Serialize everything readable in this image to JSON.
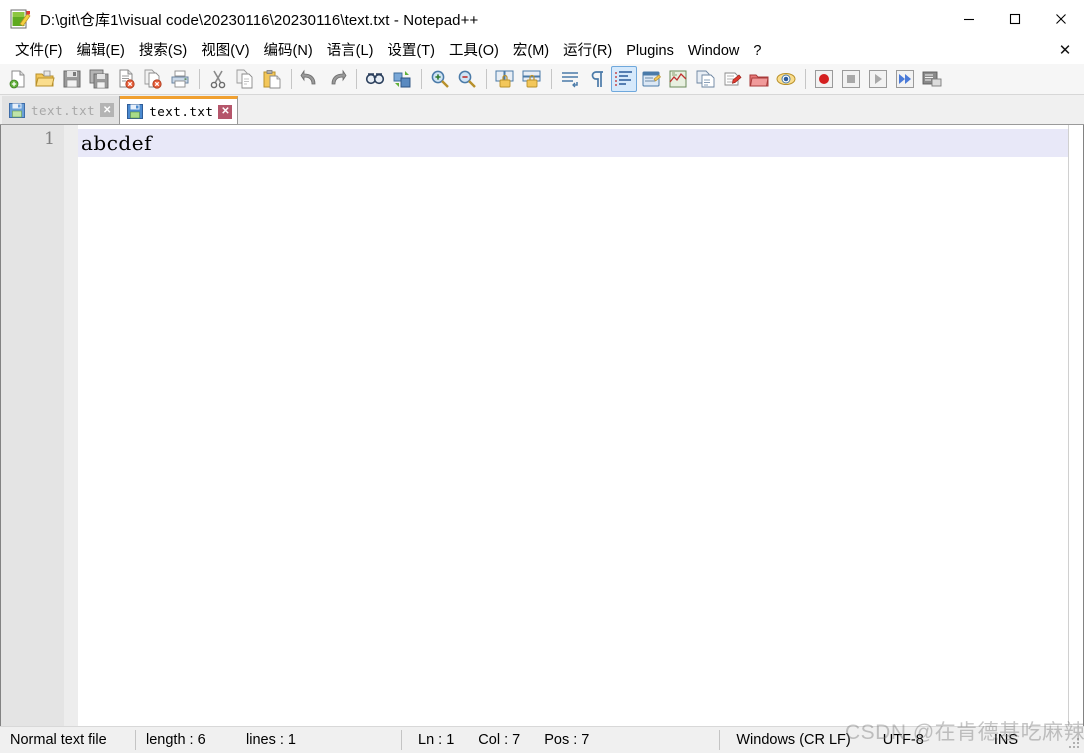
{
  "window": {
    "title": "D:\\git\\仓库1\\visual code\\20230116\\20230116\\text.txt - Notepad++",
    "app_icon": "notepad-plus-plus-icon",
    "controls": {
      "minimize": "—",
      "maximize": "☐",
      "close": "✕"
    }
  },
  "menubar": {
    "items": [
      {
        "label": "文件(F)",
        "name": "menu-file"
      },
      {
        "label": "编辑(E)",
        "name": "menu-edit"
      },
      {
        "label": "搜索(S)",
        "name": "menu-search"
      },
      {
        "label": "视图(V)",
        "name": "menu-view"
      },
      {
        "label": "编码(N)",
        "name": "menu-encoding"
      },
      {
        "label": "语言(L)",
        "name": "menu-language"
      },
      {
        "label": "设置(T)",
        "name": "menu-settings"
      },
      {
        "label": "工具(O)",
        "name": "menu-tools"
      },
      {
        "label": "宏(M)",
        "name": "menu-macro"
      },
      {
        "label": "运行(R)",
        "name": "menu-run"
      },
      {
        "label": "Plugins",
        "name": "menu-plugins"
      },
      {
        "label": "Window",
        "name": "menu-window"
      },
      {
        "label": "?",
        "name": "menu-help"
      }
    ],
    "close_document": "✕"
  },
  "toolbar": {
    "buttons": [
      {
        "name": "new-file-icon",
        "type": "icon"
      },
      {
        "name": "open-file-icon",
        "type": "icon"
      },
      {
        "name": "save-icon",
        "type": "icon"
      },
      {
        "name": "save-all-icon",
        "type": "icon"
      },
      {
        "name": "close-file-icon",
        "type": "icon"
      },
      {
        "name": "close-all-files-icon",
        "type": "icon"
      },
      {
        "name": "print-icon",
        "type": "icon"
      },
      {
        "name": "separator",
        "type": "sep"
      },
      {
        "name": "cut-icon",
        "type": "icon"
      },
      {
        "name": "copy-icon",
        "type": "icon"
      },
      {
        "name": "paste-icon",
        "type": "icon"
      },
      {
        "name": "separator",
        "type": "sep"
      },
      {
        "name": "undo-icon",
        "type": "icon"
      },
      {
        "name": "redo-icon",
        "type": "icon"
      },
      {
        "name": "separator",
        "type": "sep"
      },
      {
        "name": "find-icon",
        "type": "icon"
      },
      {
        "name": "replace-icon",
        "type": "icon"
      },
      {
        "name": "separator",
        "type": "sep"
      },
      {
        "name": "zoom-in-icon",
        "type": "icon"
      },
      {
        "name": "zoom-out-icon",
        "type": "icon"
      },
      {
        "name": "separator",
        "type": "sep"
      },
      {
        "name": "sync-vertical-scroll-icon",
        "type": "icon"
      },
      {
        "name": "sync-horizontal-scroll-icon",
        "type": "icon"
      },
      {
        "name": "separator",
        "type": "sep"
      },
      {
        "name": "word-wrap-icon",
        "type": "icon"
      },
      {
        "name": "show-all-characters-icon",
        "type": "icon"
      },
      {
        "name": "show-indent-guide-icon",
        "type": "icon",
        "active": true
      },
      {
        "name": "user-defined-dialog-icon",
        "type": "icon"
      },
      {
        "name": "document-map-icon",
        "type": "icon"
      },
      {
        "name": "function-list-icon",
        "type": "icon"
      },
      {
        "name": "folder-as-workspace-icon",
        "type": "icon"
      },
      {
        "name": "monitoring-icon",
        "type": "icon"
      },
      {
        "name": "document-preview-icon",
        "type": "icon"
      },
      {
        "name": "separator",
        "type": "sep"
      },
      {
        "name": "record-macro-icon",
        "type": "icon"
      },
      {
        "name": "stop-recording-icon",
        "type": "icon"
      },
      {
        "name": "play-macro-icon",
        "type": "icon"
      },
      {
        "name": "run-macro-multiple-icon",
        "type": "icon"
      },
      {
        "name": "run-icon",
        "type": "icon"
      }
    ]
  },
  "tabs": [
    {
      "label": "text.txt",
      "active": false,
      "icon": "saved-file-icon",
      "close": "✕"
    },
    {
      "label": "text.txt",
      "active": true,
      "icon": "saved-file-icon",
      "close": "✕"
    }
  ],
  "editor": {
    "lines": [
      {
        "number": "1",
        "text": "abcdef",
        "current": true
      }
    ]
  },
  "statusbar": {
    "file_type": "Normal text file",
    "length_label": "length : 6",
    "lines_label": "lines : 1",
    "ln": "Ln : 1",
    "col": "Col : 7",
    "pos": "Pos : 7",
    "eol": "Windows (CR LF)",
    "encoding": "UTF-8",
    "insert_mode": "INS"
  },
  "watermark": {
    "text": "CSDN @在肯德基吃麻辣烫"
  },
  "colors": {
    "active_tab_accent": "#f0a030",
    "active_tab_close": "#b5566b",
    "current_line_highlight": "#e8e8f8",
    "toolbar_active": "#d6e9fb",
    "gutter_bg": "#e4e4e4"
  }
}
